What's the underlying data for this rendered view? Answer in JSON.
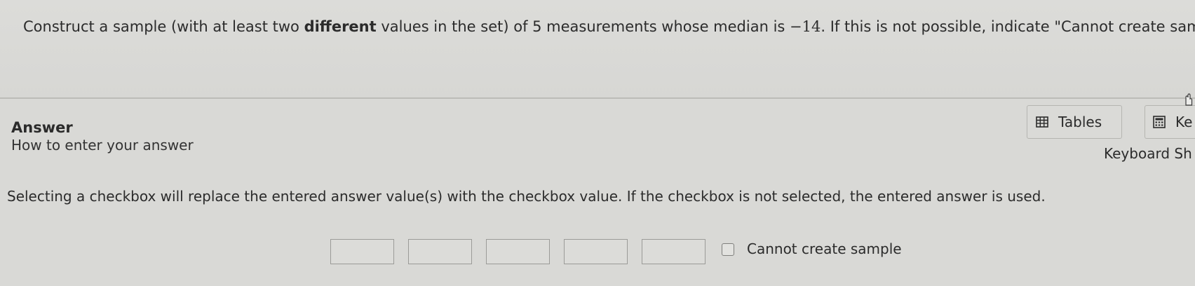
{
  "question": {
    "part1": "Construct a sample (with at least two ",
    "emphasis": "different",
    "part2": " values in the set) of 5 measurements whose median is ",
    "median_value": "−14",
    "part3": ". If this is not possible, indicate \"Cannot create sample\"."
  },
  "answer": {
    "label": "Answer",
    "how_to_link": "How to enter your answer"
  },
  "toolbar": {
    "tables_label": "Tables",
    "keypad_label": "Ke",
    "keyboard_shortcuts_label": "Keyboard Sh"
  },
  "instructions": "Selecting a checkbox will replace the entered answer value(s) with the checkbox value. If the checkbox is not selected, the entered answer is used.",
  "inputs": {
    "values": [
      "",
      "",
      "",
      "",
      ""
    ]
  },
  "checkbox": {
    "label": "Cannot create sample",
    "checked": false
  },
  "icons": {
    "tables": "table-icon",
    "keypad": "calculator-icon"
  }
}
